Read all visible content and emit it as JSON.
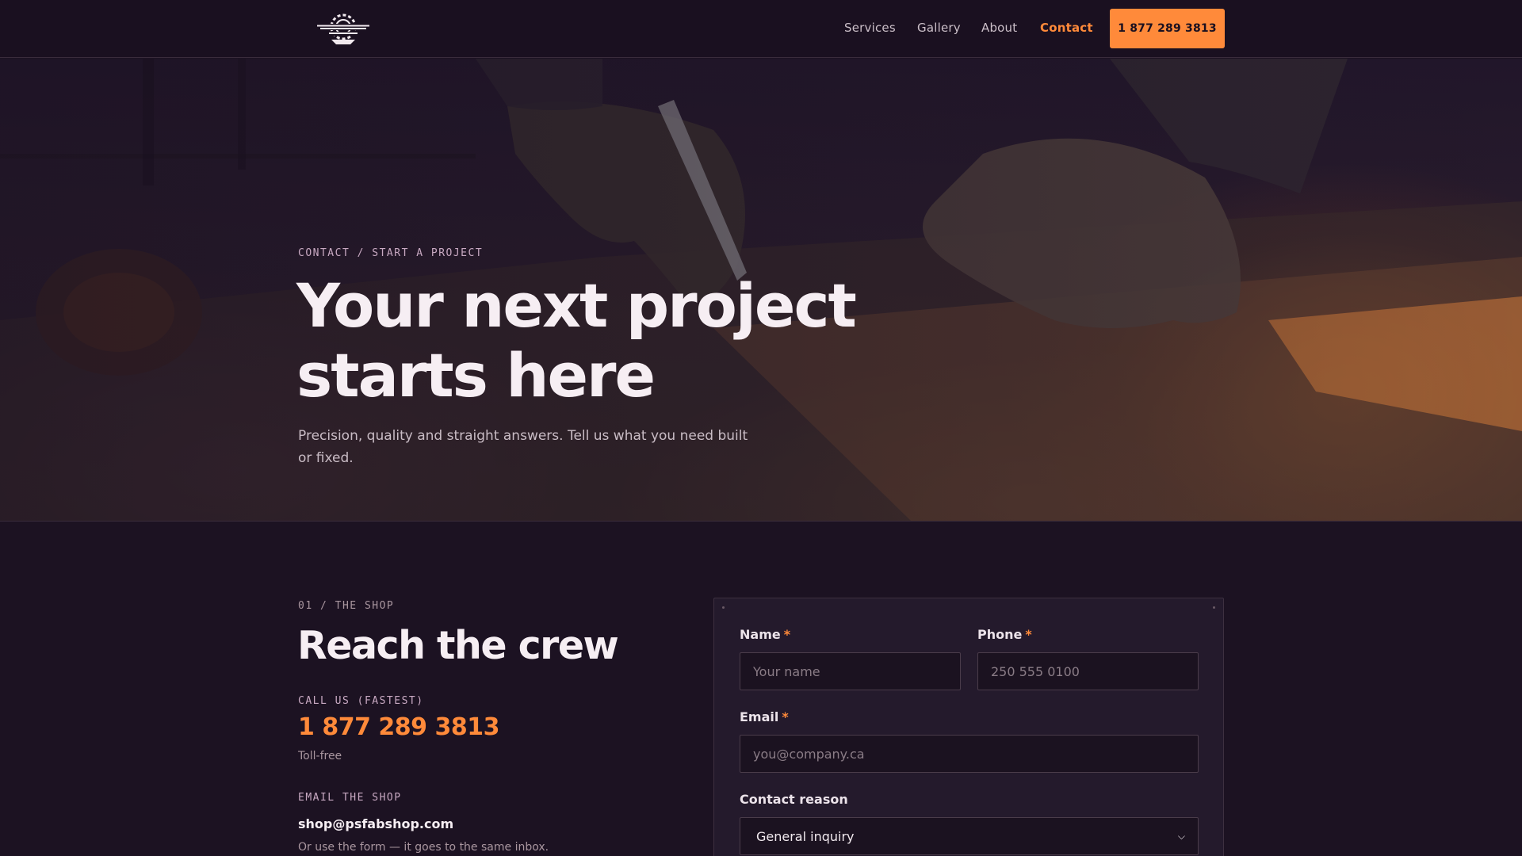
{
  "header": {
    "logo_text": "PURPLE SPRINGS FAB SHOP",
    "nav": [
      {
        "label": "Services",
        "active": false
      },
      {
        "label": "Gallery",
        "active": false
      },
      {
        "label": "About",
        "active": false
      },
      {
        "label": "Contact",
        "active": true
      }
    ],
    "call_button": "1 877 289 3813"
  },
  "hero": {
    "breadcrumb": "CONTACT / START A PROJECT",
    "title_line1": "Your next project",
    "title_line2": "starts here",
    "subtitle": "Precision, quality and straight answers. Tell us what you need built or fixed."
  },
  "contact": {
    "section_label": "01 / THE SHOP",
    "title": "Reach the crew",
    "call_label": "CALL US (FASTEST)",
    "phone": "1 877 289 3813",
    "phone_note": "Toll-free",
    "email_label": "EMAIL THE SHOP",
    "email": "shop@psfabshop.com",
    "email_note": "Or use the form — it goes to the same inbox."
  },
  "form": {
    "name_label": "Name",
    "name_placeholder": "Your name",
    "phone_label": "Phone",
    "phone_placeholder": "250 555 0100",
    "email_label": "Email",
    "email_placeholder": "you@company.ca",
    "reason_label": "Contact reason",
    "reason_value": "General inquiry",
    "required_mark": "*"
  },
  "colors": {
    "accent": "#ff8a3a",
    "background": "#1c1222",
    "card": "#241a2c"
  }
}
